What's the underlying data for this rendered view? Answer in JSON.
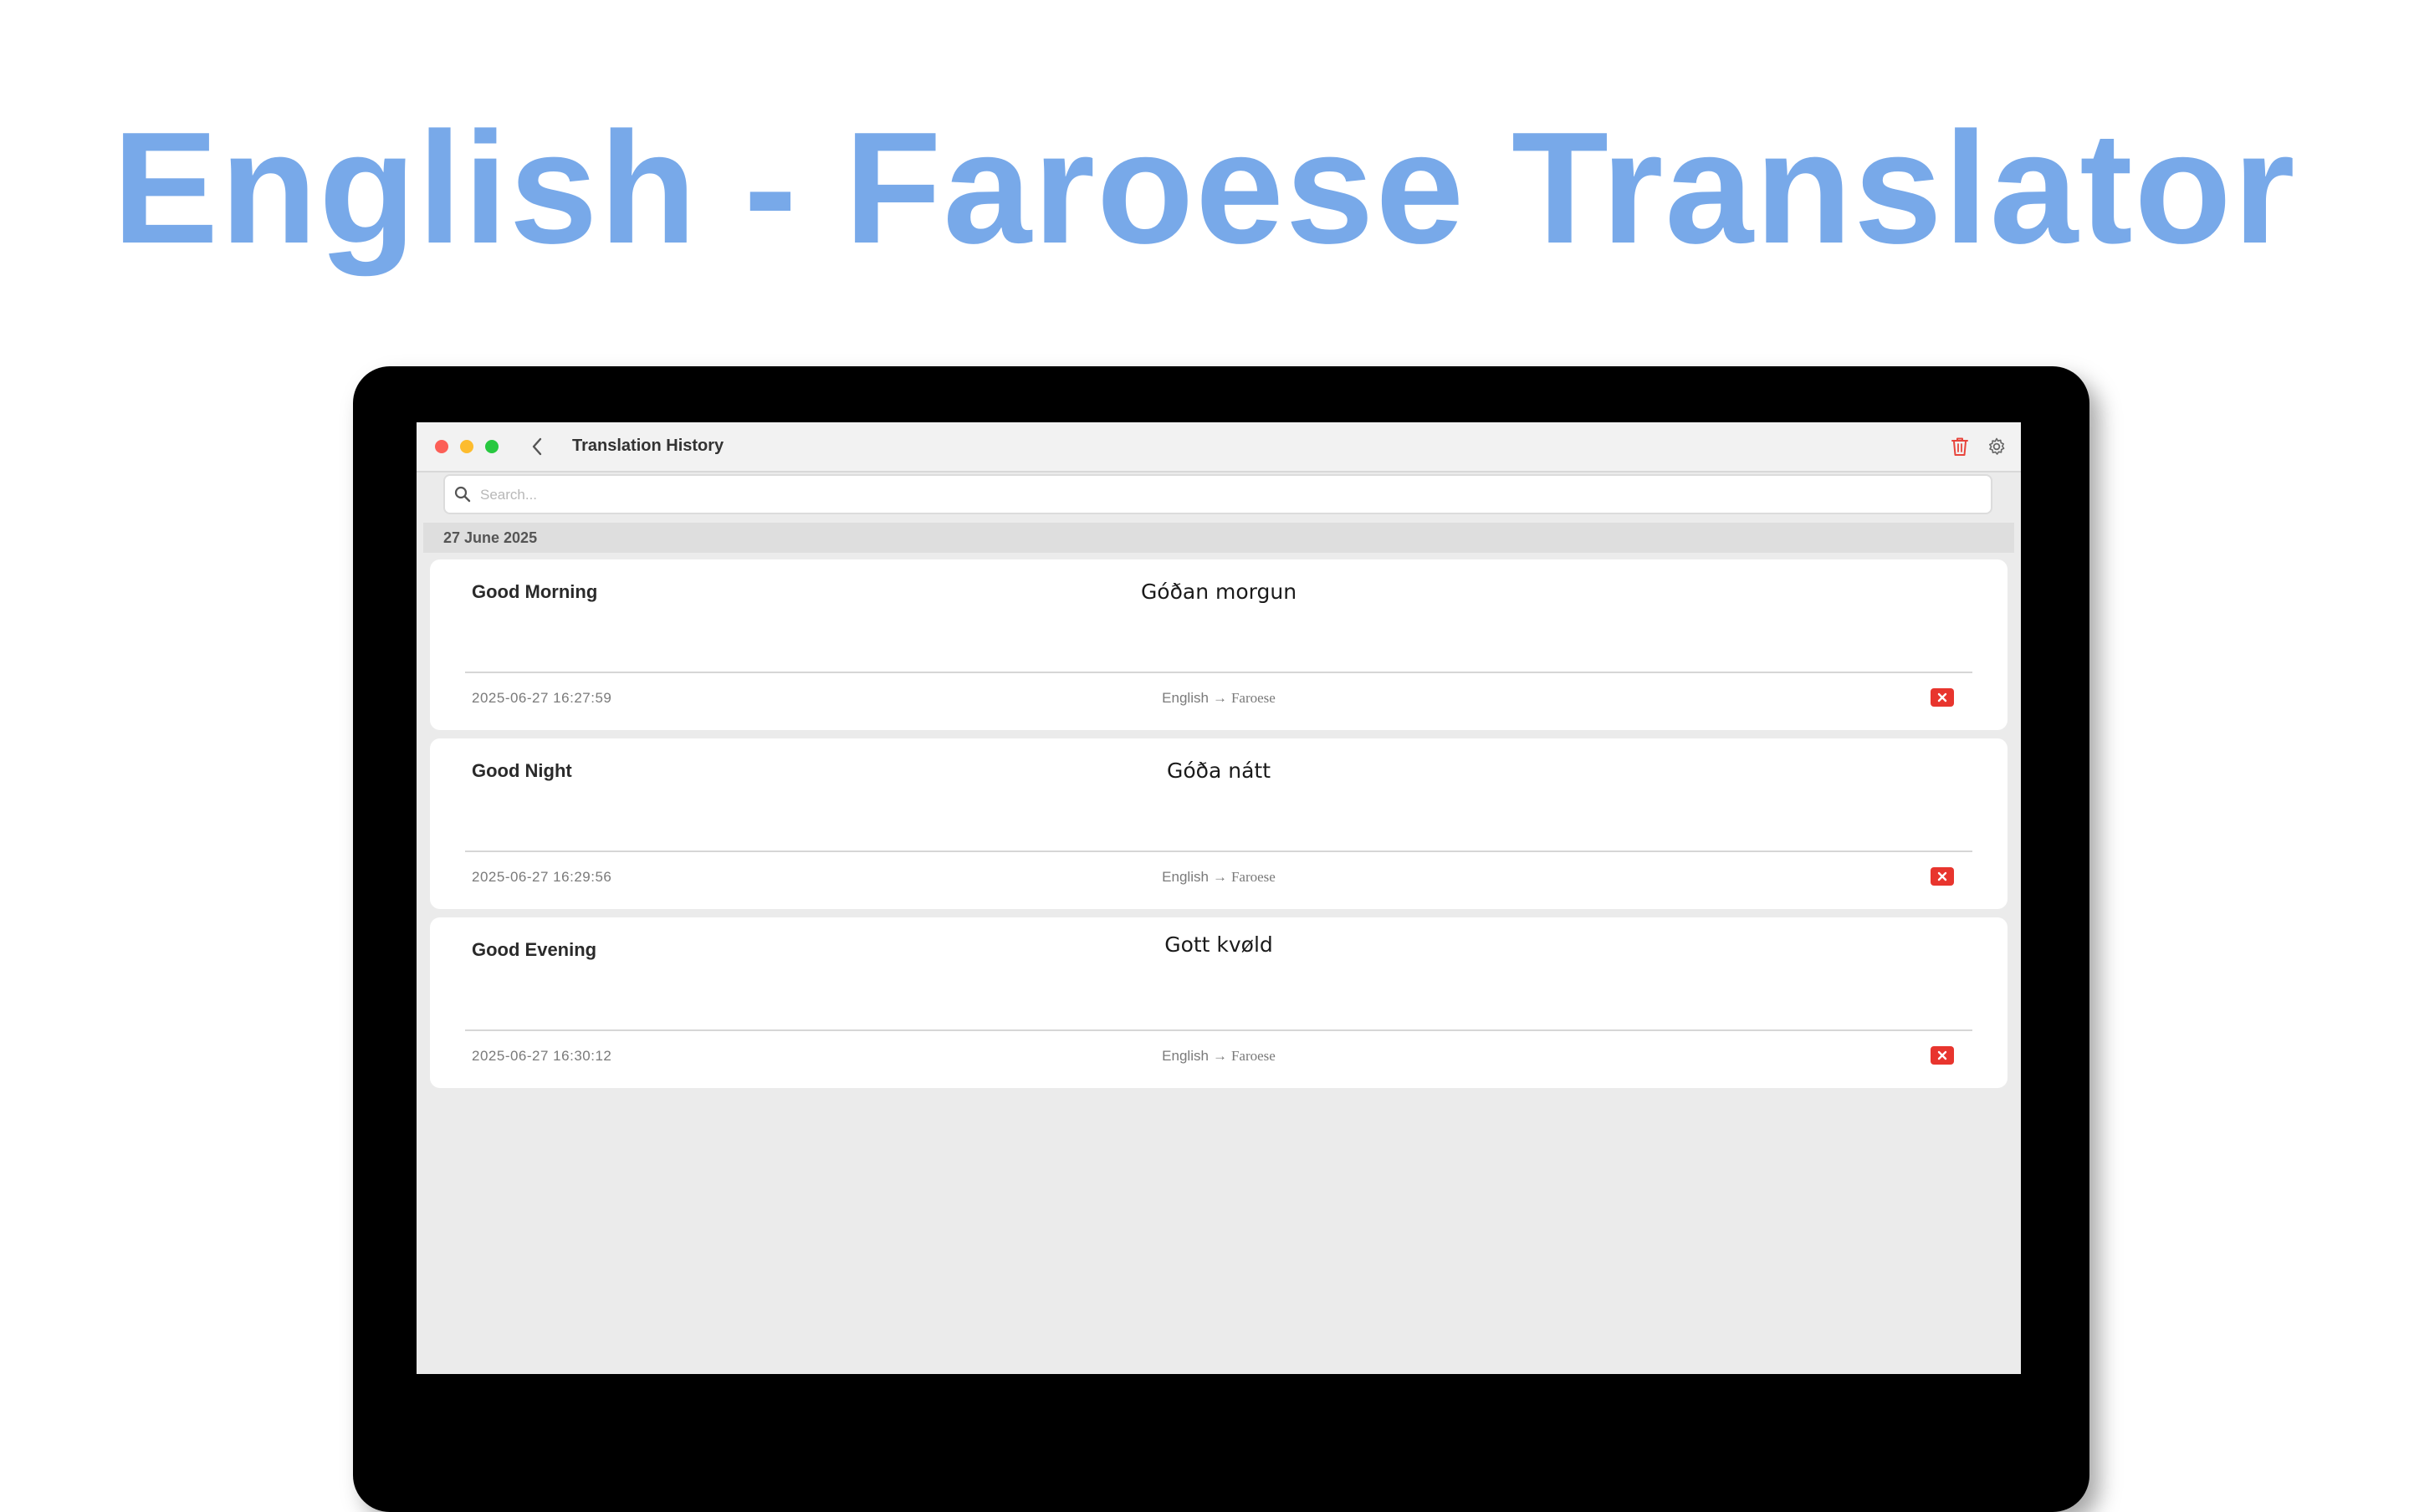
{
  "headline": "English - Faroese Translator",
  "window": {
    "title": "Translation History"
  },
  "search": {
    "placeholder": "Search..."
  },
  "history": {
    "date_group": "27 June 2025",
    "entries": [
      {
        "source": "Good Morning",
        "target": "Góðan morgun",
        "timestamp": "2025-06-27 16:27:59",
        "from_lang": "English",
        "arrow": "→",
        "to_lang": "Faroese"
      },
      {
        "source": "Good Night",
        "target": "Góða nátt",
        "timestamp": "2025-06-27 16:29:56",
        "from_lang": "English",
        "arrow": "→",
        "to_lang": "Faroese"
      },
      {
        "source": "Good Evening",
        "target": "Gott kvøld",
        "timestamp": "2025-06-27 16:30:12",
        "from_lang": "English",
        "arrow": "→",
        "to_lang": "Faroese"
      }
    ]
  },
  "icons": {
    "back": "chevron-left-icon",
    "trash": "trash-icon",
    "settings": "gear-icon",
    "search": "search-icon",
    "delete": "close-icon"
  },
  "colors": {
    "headline": "#78a9e9",
    "delete_button": "#e8352e",
    "trash_icon": "#e8453c",
    "traffic_red": "#fc5f57",
    "traffic_yellow": "#fdbc2e",
    "traffic_green": "#28c840"
  }
}
